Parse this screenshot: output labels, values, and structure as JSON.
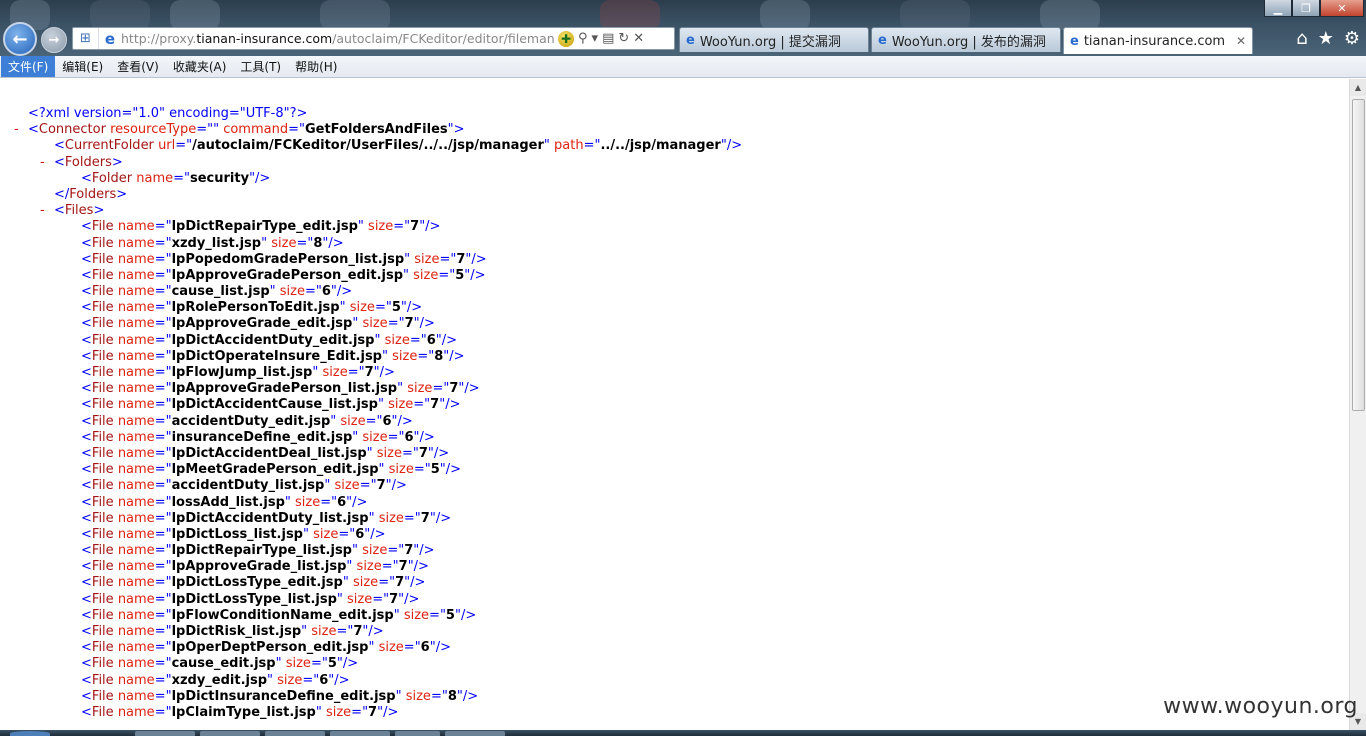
{
  "window": {
    "controls": {
      "minimize": "▁",
      "maximize": "❐",
      "close": "✕"
    }
  },
  "nav": {
    "back_icon": "arrow-left-icon",
    "forward_icon": "arrow-right-icon"
  },
  "address_bar": {
    "url_prefix": "http://proxy.",
    "url_domain": "tianan-insurance.com",
    "url_path": "/autoclaim/FCKeditor/editor/filemanager"
  },
  "tabs": [
    {
      "label": "WooYun.org | 提交漏洞"
    },
    {
      "label": "WooYun.org | 发布的漏洞"
    },
    {
      "label": "tianan-insurance.com"
    }
  ],
  "menu": [
    "文件(F)",
    "编辑(E)",
    "查看(V)",
    "收藏夹(A)",
    "工具(T)",
    "帮助(H)"
  ],
  "xml": {
    "declaration": "<?xml version=\"1.0\" encoding=\"UTF-8\"?>",
    "connector": {
      "resourceType": "",
      "command": "GetFoldersAndFiles"
    },
    "current_folder": {
      "url": "/autoclaim/FCKeditor/UserFiles/../../jsp/manager",
      "path": "../../jsp/manager"
    },
    "folders": [
      {
        "name": "security"
      }
    ],
    "files": [
      {
        "name": "lpDictRepairType_edit.jsp",
        "size": "7"
      },
      {
        "name": "xzdy_list.jsp",
        "size": "8"
      },
      {
        "name": "lpPopedomGradePerson_list.jsp",
        "size": "7"
      },
      {
        "name": "lpApproveGradePerson_edit.jsp",
        "size": "5"
      },
      {
        "name": "cause_list.jsp",
        "size": "6"
      },
      {
        "name": "lpRolePersonToEdit.jsp",
        "size": "5"
      },
      {
        "name": "lpApproveGrade_edit.jsp",
        "size": "7"
      },
      {
        "name": "lpDictAccidentDuty_edit.jsp",
        "size": "6"
      },
      {
        "name": "lpDictOperateInsure_Edit.jsp",
        "size": "8"
      },
      {
        "name": "lpFlowJump_list.jsp",
        "size": "7"
      },
      {
        "name": "lpApproveGradePerson_list.jsp",
        "size": "7"
      },
      {
        "name": "lpDictAccidentCause_list.jsp",
        "size": "7"
      },
      {
        "name": "accidentDuty_edit.jsp",
        "size": "6"
      },
      {
        "name": "insuranceDefine_edit.jsp",
        "size": "6"
      },
      {
        "name": "lpDictAccidentDeal_list.jsp",
        "size": "7"
      },
      {
        "name": "lpMeetGradePerson_edit.jsp",
        "size": "5"
      },
      {
        "name": "accidentDuty_list.jsp",
        "size": "7"
      },
      {
        "name": "lossAdd_list.jsp",
        "size": "6"
      },
      {
        "name": "lpDictAccidentDuty_list.jsp",
        "size": "7"
      },
      {
        "name": "lpDictLoss_list.jsp",
        "size": "6"
      },
      {
        "name": "lpDictRepairType_list.jsp",
        "size": "7"
      },
      {
        "name": "lpApproveGrade_list.jsp",
        "size": "7"
      },
      {
        "name": "lpDictLossType_edit.jsp",
        "size": "7"
      },
      {
        "name": "lpDictLossType_list.jsp",
        "size": "7"
      },
      {
        "name": "lpFlowConditionName_edit.jsp",
        "size": "5"
      },
      {
        "name": "lpDictRisk_list.jsp",
        "size": "7"
      },
      {
        "name": "lpOperDeptPerson_edit.jsp",
        "size": "6"
      },
      {
        "name": "cause_edit.jsp",
        "size": "5"
      },
      {
        "name": "xzdy_edit.jsp",
        "size": "6"
      },
      {
        "name": "lpDictInsuranceDefine_edit.jsp",
        "size": "8"
      },
      {
        "name": "lpClaimType_list.jsp",
        "size": "7"
      }
    ]
  },
  "watermark": "www.wooyun.org"
}
